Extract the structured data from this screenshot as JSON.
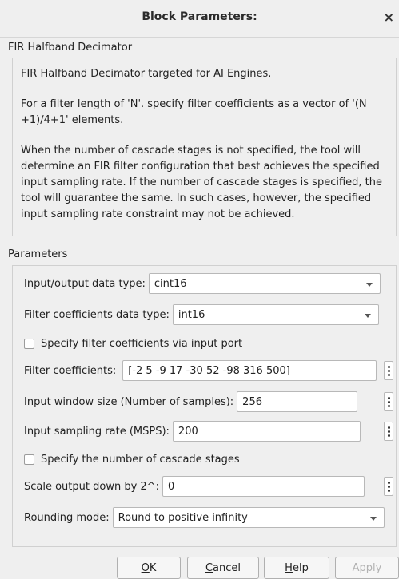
{
  "window": {
    "title": "Block Parameters:",
    "close": "×"
  },
  "block": {
    "name": "FIR Halfband Decimator",
    "desc1": "FIR Halfband Decimator targeted for AI Engines.",
    "desc2": "For a filter length of 'N'. specify filter coefficients as a vector of '(N +1)/4+1' elements.",
    "desc3": "When the number of cascade stages is not specified, the tool will determine an FIR filter configuration that best achieves the specified input sampling rate. If the number of cascade stages is specified, the tool will guarantee the same. In such cases, however, the specified input sampling rate constraint may not be achieved."
  },
  "parameters": {
    "section_label": "Parameters",
    "io_type": {
      "label": "Input/output data type:",
      "value": "cint16"
    },
    "coef_type": {
      "label": "Filter coefficients data type:",
      "value": "int16"
    },
    "coef_port": {
      "label": "Specify filter coefficients via input port",
      "checked": false
    },
    "coefficients": {
      "label": "Filter coefficients:",
      "value": "[-2 5 -9 17 -30 52 -98 316 500]"
    },
    "window_size": {
      "label": "Input window size (Number of samples):",
      "value": "256"
    },
    "sampling_rate": {
      "label": "Input sampling rate (MSPS):",
      "value": "200"
    },
    "cascade": {
      "label": "Specify the number of cascade stages",
      "checked": false
    },
    "scale": {
      "label": "Scale output down by 2^:",
      "value": "0"
    },
    "rounding": {
      "label": "Rounding mode:",
      "value": "Round to positive infinity"
    }
  },
  "buttons": {
    "ok": {
      "mnemonic": "O",
      "rest": "K"
    },
    "cancel": {
      "mnemonic": "C",
      "rest": "ancel"
    },
    "help": {
      "mnemonic": "H",
      "rest": "elp"
    },
    "apply": {
      "label": "Apply"
    }
  }
}
